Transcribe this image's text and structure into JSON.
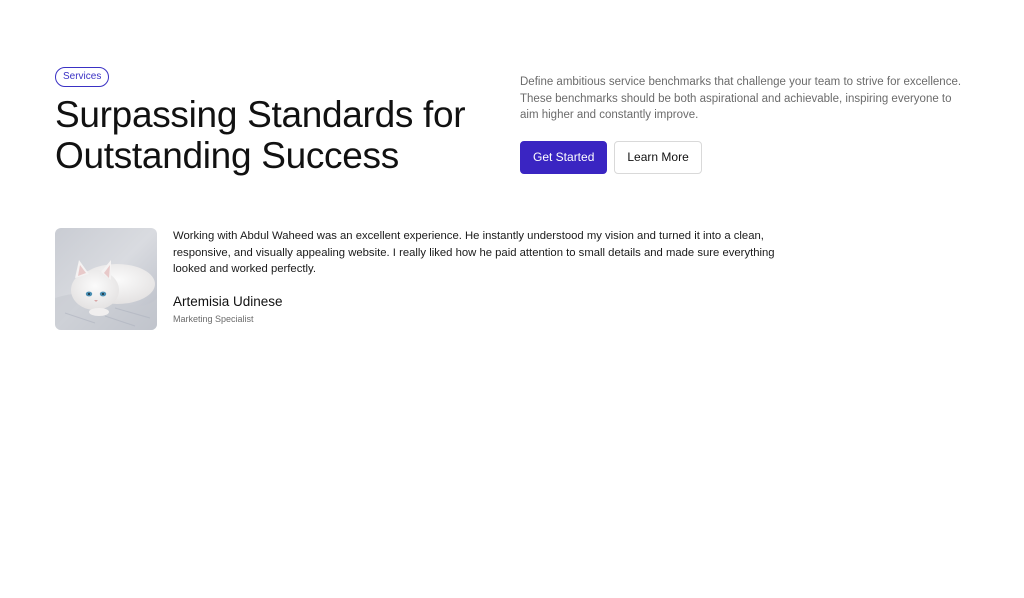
{
  "hero": {
    "badge": "Services",
    "headline_line1": "Surpassing Standards for",
    "headline_line2": "Outstanding Success",
    "description": "Define ambitious service benchmarks that challenge your team to strive for excellence. These benchmarks should be both aspirational and achievable, inspiring everyone to aim higher and constantly improve.",
    "primary_button": "Get Started",
    "secondary_button": "Learn More"
  },
  "testimonial": {
    "quote": "Working with Abdul Waheed was an excellent experience. He instantly understood my vision and turned it into a clean, responsive, and visually appealing website. I really liked how he paid attention to small details and made sure everything looked and worked perfectly.",
    "author_name": "Artemisia Udinese",
    "author_role": "Marketing Specialist"
  },
  "colors": {
    "accent": "#3a25c2",
    "heading": "#111111",
    "muted_text": "#6b6b6b",
    "button_border": "#d9d9d9"
  }
}
